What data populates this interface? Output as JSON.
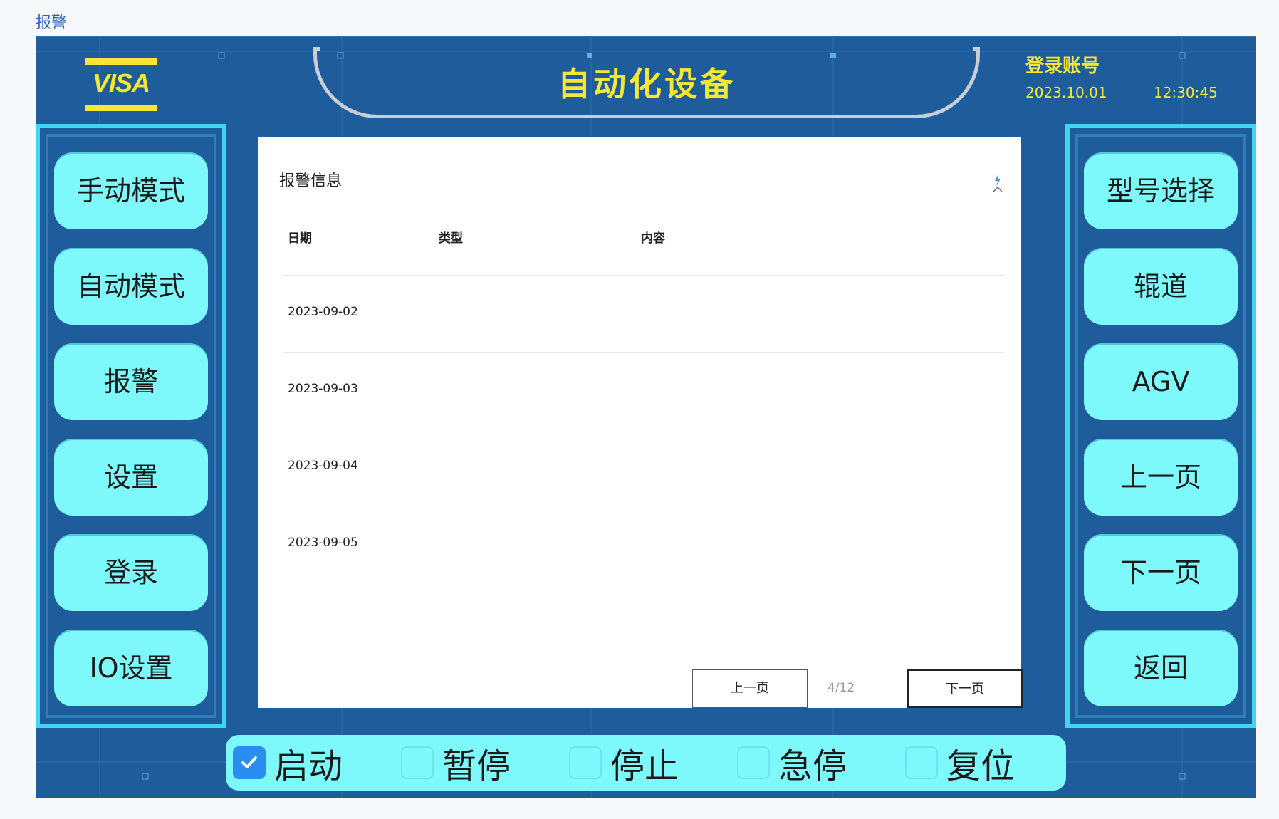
{
  "page_label": "报警",
  "header": {
    "title": "自动化设备",
    "logo_text": "VISA",
    "login_label": "登录账号",
    "date": "2023.10.01",
    "time": "12:30:45"
  },
  "left_nav": [
    {
      "label": "手动模式"
    },
    {
      "label": "自动模式"
    },
    {
      "label": "报警"
    },
    {
      "label": "设置"
    },
    {
      "label": "登录"
    },
    {
      "label": "IO设置"
    }
  ],
  "right_nav": [
    {
      "label": "型号选择"
    },
    {
      "label": "辊道"
    },
    {
      "label": "AGV"
    },
    {
      "label": "上一页"
    },
    {
      "label": "下一页"
    },
    {
      "label": "返回"
    }
  ],
  "alarm_panel": {
    "title": "报警信息",
    "columns": [
      "日期",
      "类型",
      "内容"
    ],
    "rows": [
      {
        "date": "2023-09-02",
        "type": "",
        "content": ""
      },
      {
        "date": "2023-09-03",
        "type": "",
        "content": ""
      },
      {
        "date": "2023-09-04",
        "type": "",
        "content": ""
      },
      {
        "date": "2023-09-05",
        "type": "",
        "content": ""
      }
    ],
    "pagination": {
      "prev_label": "上一页",
      "page_info": "4/12",
      "next_label": "下一页"
    }
  },
  "controls": [
    {
      "label": "启动",
      "checked": true
    },
    {
      "label": "暂停",
      "checked": false
    },
    {
      "label": "停止",
      "checked": false
    },
    {
      "label": "急停",
      "checked": false
    },
    {
      "label": "复位",
      "checked": false
    }
  ],
  "colors": {
    "background": "#1e5c9c",
    "accent": "#7ef9fb",
    "title_text": "#f6e832",
    "panel_border": "#3fd6ee",
    "checked": "#2a8df0"
  }
}
